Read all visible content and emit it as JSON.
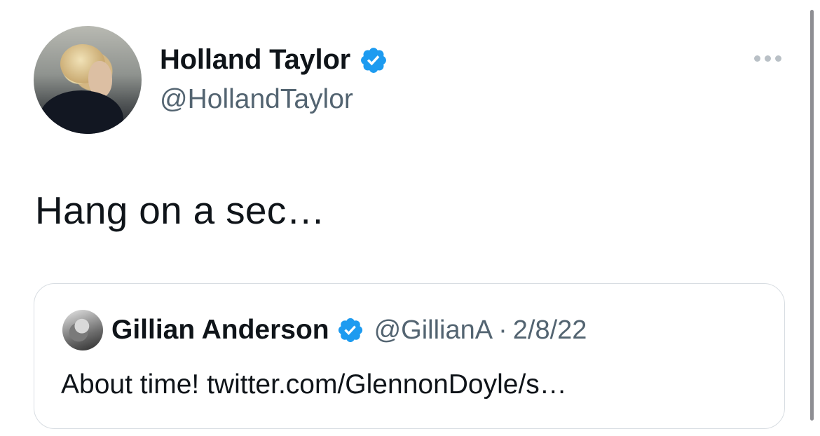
{
  "tweet": {
    "author_name": "Holland Taylor",
    "author_handle": "@HollandTaylor",
    "text": "Hang on a sec…"
  },
  "quoted_tweet": {
    "author_name": "Gillian Anderson",
    "author_handle": "@GillianA",
    "separator": "·",
    "date": "2/8/22",
    "text": "About time! twitter.com/GlennonDoyle/s…"
  },
  "icons": {
    "verified": "verified-badge-icon",
    "more": "more-options-icon"
  },
  "colors": {
    "verified_blue": "#1d9bf0",
    "secondary_text": "#536471",
    "primary_text": "#0f1419"
  }
}
